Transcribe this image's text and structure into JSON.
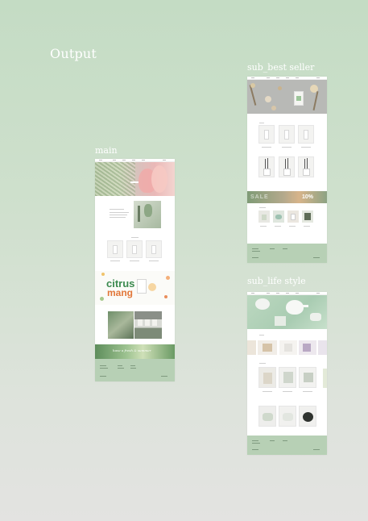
{
  "headings": {
    "output": "Output",
    "main": "main",
    "sub_best_seller": "sub_best seller",
    "sub_life_style": "sub_life style"
  },
  "main_page": {
    "promo_title_line1": "citrus",
    "promo_title_line2": "mang",
    "banner_text": "have a fresh & summer",
    "colors": {
      "accent_green": "#6ea06b",
      "promo_orange": "#e2773a",
      "promo_green": "#3b8a4f"
    }
  },
  "sub_best_seller": {
    "sale_banner_text": "SALE",
    "sale_discount": "10%"
  },
  "sub_life_style": {},
  "colors": {
    "background_top": "#c4dcc4",
    "background_bottom": "#e3e3e1",
    "footer_green": "#b7d0b5"
  }
}
